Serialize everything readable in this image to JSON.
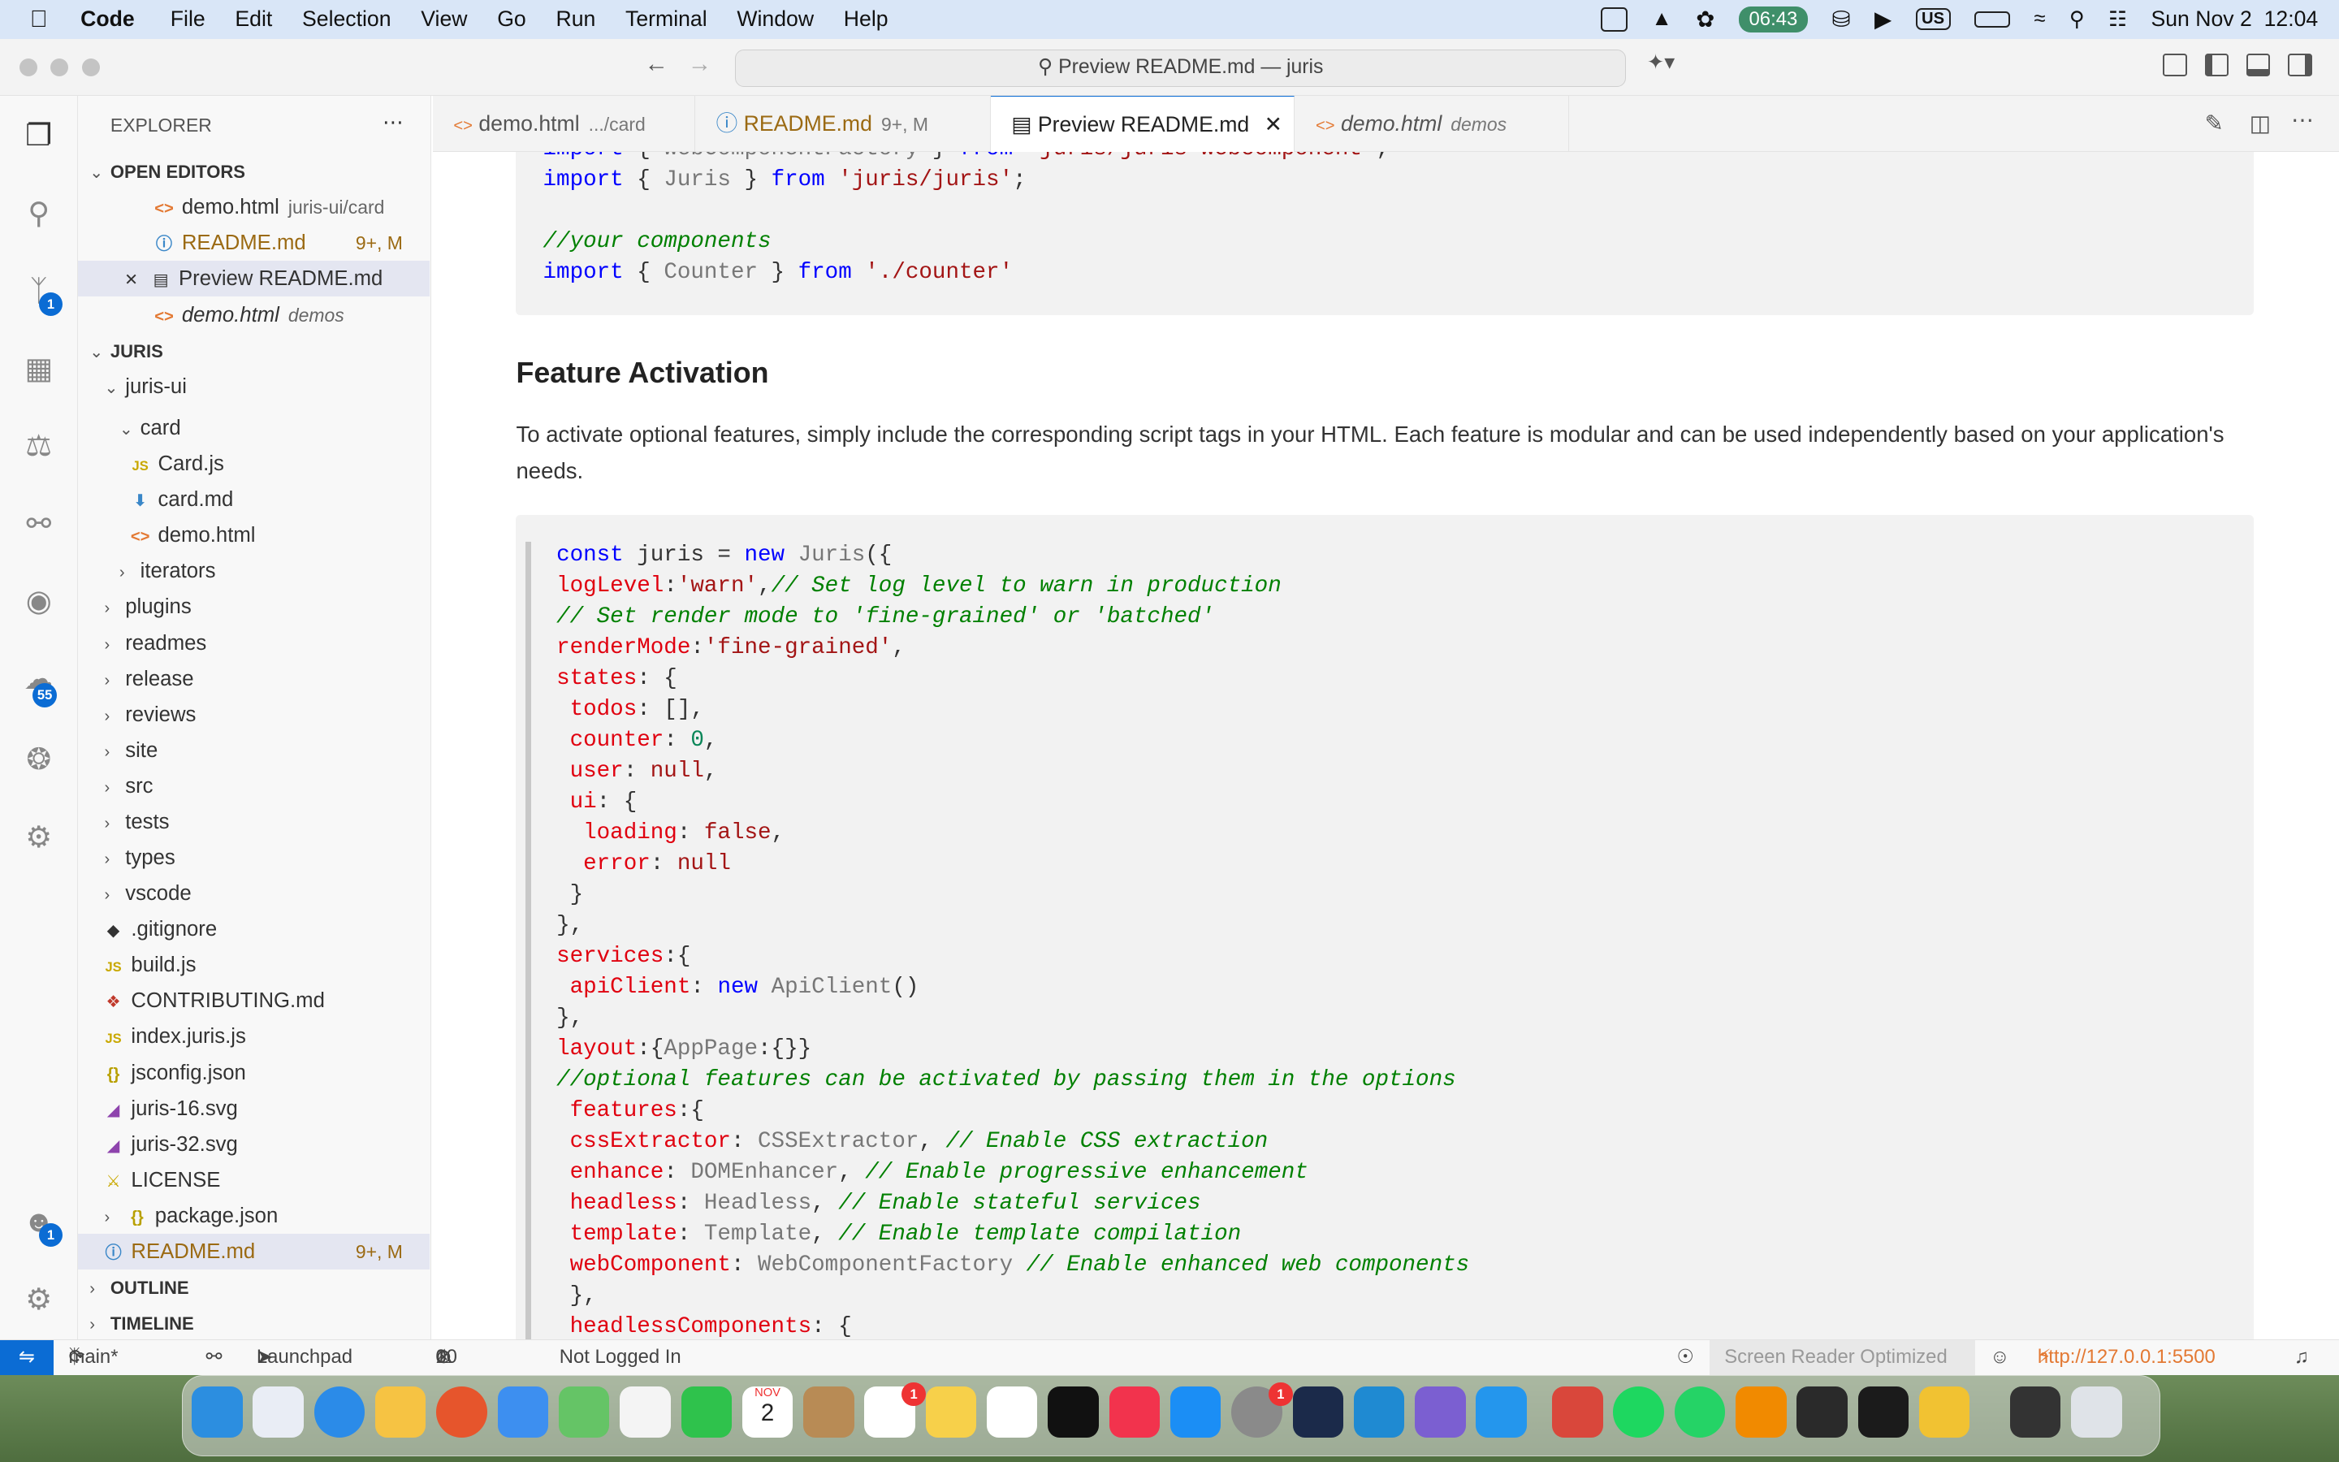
{
  "menubar": {
    "app": "Code",
    "items": [
      "File",
      "Edit",
      "Selection",
      "View",
      "Go",
      "Run",
      "Terminal",
      "Window",
      "Help"
    ],
    "timer": "06:43",
    "input_source": "US",
    "datetime": "Sun Nov 2  12:04"
  },
  "titlebar": {
    "command_center": "Preview README.md — juris"
  },
  "explorer": {
    "title": "EXPLORER",
    "open_editors_label": "OPEN EDITORS",
    "open_editors": [
      {
        "name": "demo.html",
        "desc": "juris-ui/card"
      },
      {
        "name": "README.md",
        "badge": "9+, M"
      },
      {
        "name": "Preview README.md"
      },
      {
        "name": "demo.html",
        "desc": "demos"
      }
    ],
    "project_label": "JURIS",
    "tree": [
      {
        "name": "juris-ui"
      },
      {
        "name": "card"
      },
      {
        "name": "Card.js"
      },
      {
        "name": "card.md"
      },
      {
        "name": "demo.html"
      },
      {
        "name": "iterators"
      },
      {
        "name": "plugins"
      },
      {
        "name": "readmes"
      },
      {
        "name": "release"
      },
      {
        "name": "reviews"
      },
      {
        "name": "site"
      },
      {
        "name": "src"
      },
      {
        "name": "tests"
      },
      {
        "name": "types"
      },
      {
        "name": "vscode"
      },
      {
        "name": ".gitignore"
      },
      {
        "name": "build.js"
      },
      {
        "name": "CONTRIBUTING.md"
      },
      {
        "name": "index.juris.js"
      },
      {
        "name": "jsconfig.json"
      },
      {
        "name": "juris-16.svg"
      },
      {
        "name": "juris-32.svg"
      },
      {
        "name": "LICENSE"
      },
      {
        "name": "package.json"
      },
      {
        "name": "README.md",
        "badge": "9+, M"
      }
    ],
    "outline_label": "OUTLINE",
    "timeline_label": "TIMELINE"
  },
  "activity": {
    "scm_badge": "1",
    "remote_badge": "55",
    "account_badge": "1"
  },
  "tabs": [
    {
      "name": "demo.html",
      "desc": ".../card"
    },
    {
      "name": "README.md",
      "desc": "9+, M"
    },
    {
      "name": "Preview README.md"
    },
    {
      "name": "demo.html",
      "desc": "demos"
    }
  ],
  "preview": {
    "heading": "Feature Activation",
    "paragraph": "To activate optional features, simply include the corresponding script tags in your HTML. Each feature is modular and can be used independently based on your application's needs."
  },
  "status": {
    "branch": "main*",
    "launchpad": "Launchpad",
    "errors": "0",
    "warnings": "10",
    "login": "Not Logged In",
    "screen_reader": "Screen Reader Optimized",
    "server": "http://127.0.0.1:5500"
  },
  "dock": {
    "calendar_month": "NOV",
    "calendar_day": "2",
    "settings_badge": "1",
    "reminders_badge": "1"
  }
}
